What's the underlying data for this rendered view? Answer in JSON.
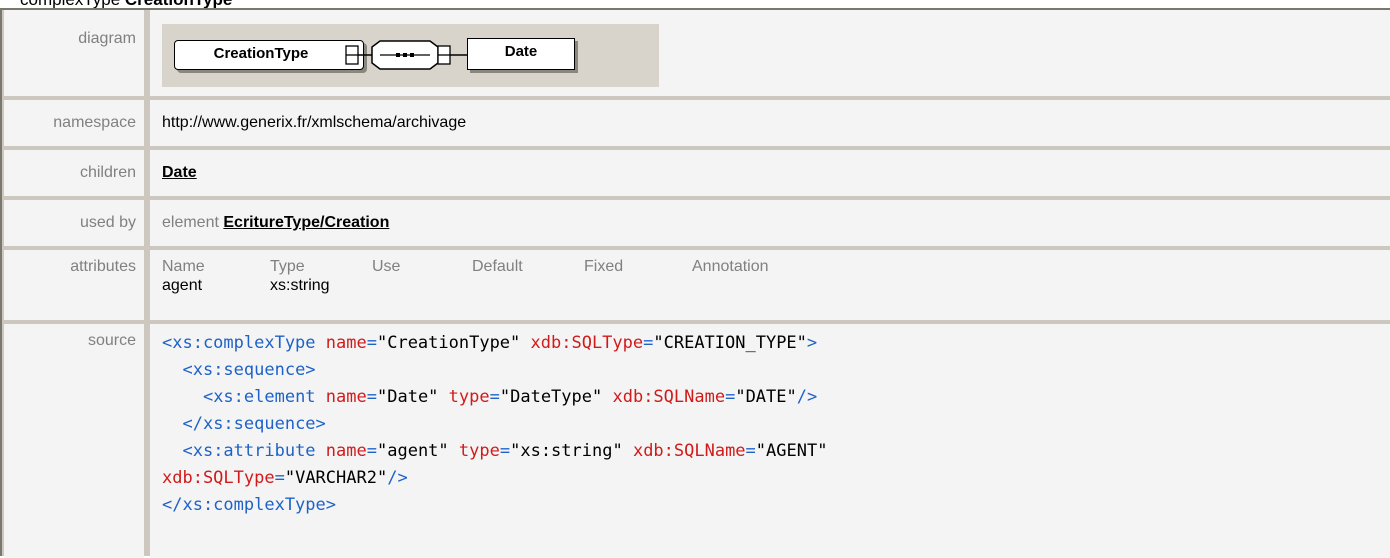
{
  "heading": {
    "prefix": "complexType",
    "name": "CreationType"
  },
  "rows": {
    "diagram": {
      "label": "diagram"
    },
    "namespace": {
      "label": "namespace",
      "value": "http://www.generix.fr/xmlschema/archivage"
    },
    "children": {
      "label": "children",
      "value": "Date"
    },
    "used_by": {
      "label": "used by",
      "prefix": "element",
      "value": "EcritureType/Creation"
    },
    "attributes": {
      "label": "attributes"
    },
    "source": {
      "label": "source"
    }
  },
  "diagram": {
    "type_node": "CreationType",
    "child_node": "Date",
    "sequence_symbol": "•••"
  },
  "attributes": {
    "columns": [
      "Name",
      "Type",
      "Use",
      "Default",
      "Fixed",
      "Annotation"
    ],
    "rows": [
      {
        "name": "agent",
        "type": "xs:string"
      }
    ]
  },
  "source": {
    "line1": {
      "tag": "<xs:complexType",
      "a1": "name",
      "v1": "\"CreationType\"",
      "a2": "xdb:SQLType",
      "v2": "\"CREATION_TYPE\"",
      "end": ">"
    },
    "line2": "<xs:sequence>",
    "line3": {
      "tag": "<xs:element",
      "a1": "name",
      "v1": "\"Date\"",
      "a2": "type",
      "v2": "\"DateType\"",
      "a3": "xdb:SQLName",
      "v3": "\"DATE\"",
      "end": "/>"
    },
    "line4": "</xs:sequence>",
    "line5": {
      "tag": "<xs:attribute",
      "a1": "name",
      "v1": "\"agent\"",
      "a2": "type",
      "v2": "\"xs:string\"",
      "a3": "xdb:SQLName",
      "v3": "\"AGENT\""
    },
    "line6": {
      "a1": "xdb:SQLType",
      "v1": "\"VARCHAR2\"",
      "end": "/>"
    },
    "line7": "</xs:complexType>"
  }
}
